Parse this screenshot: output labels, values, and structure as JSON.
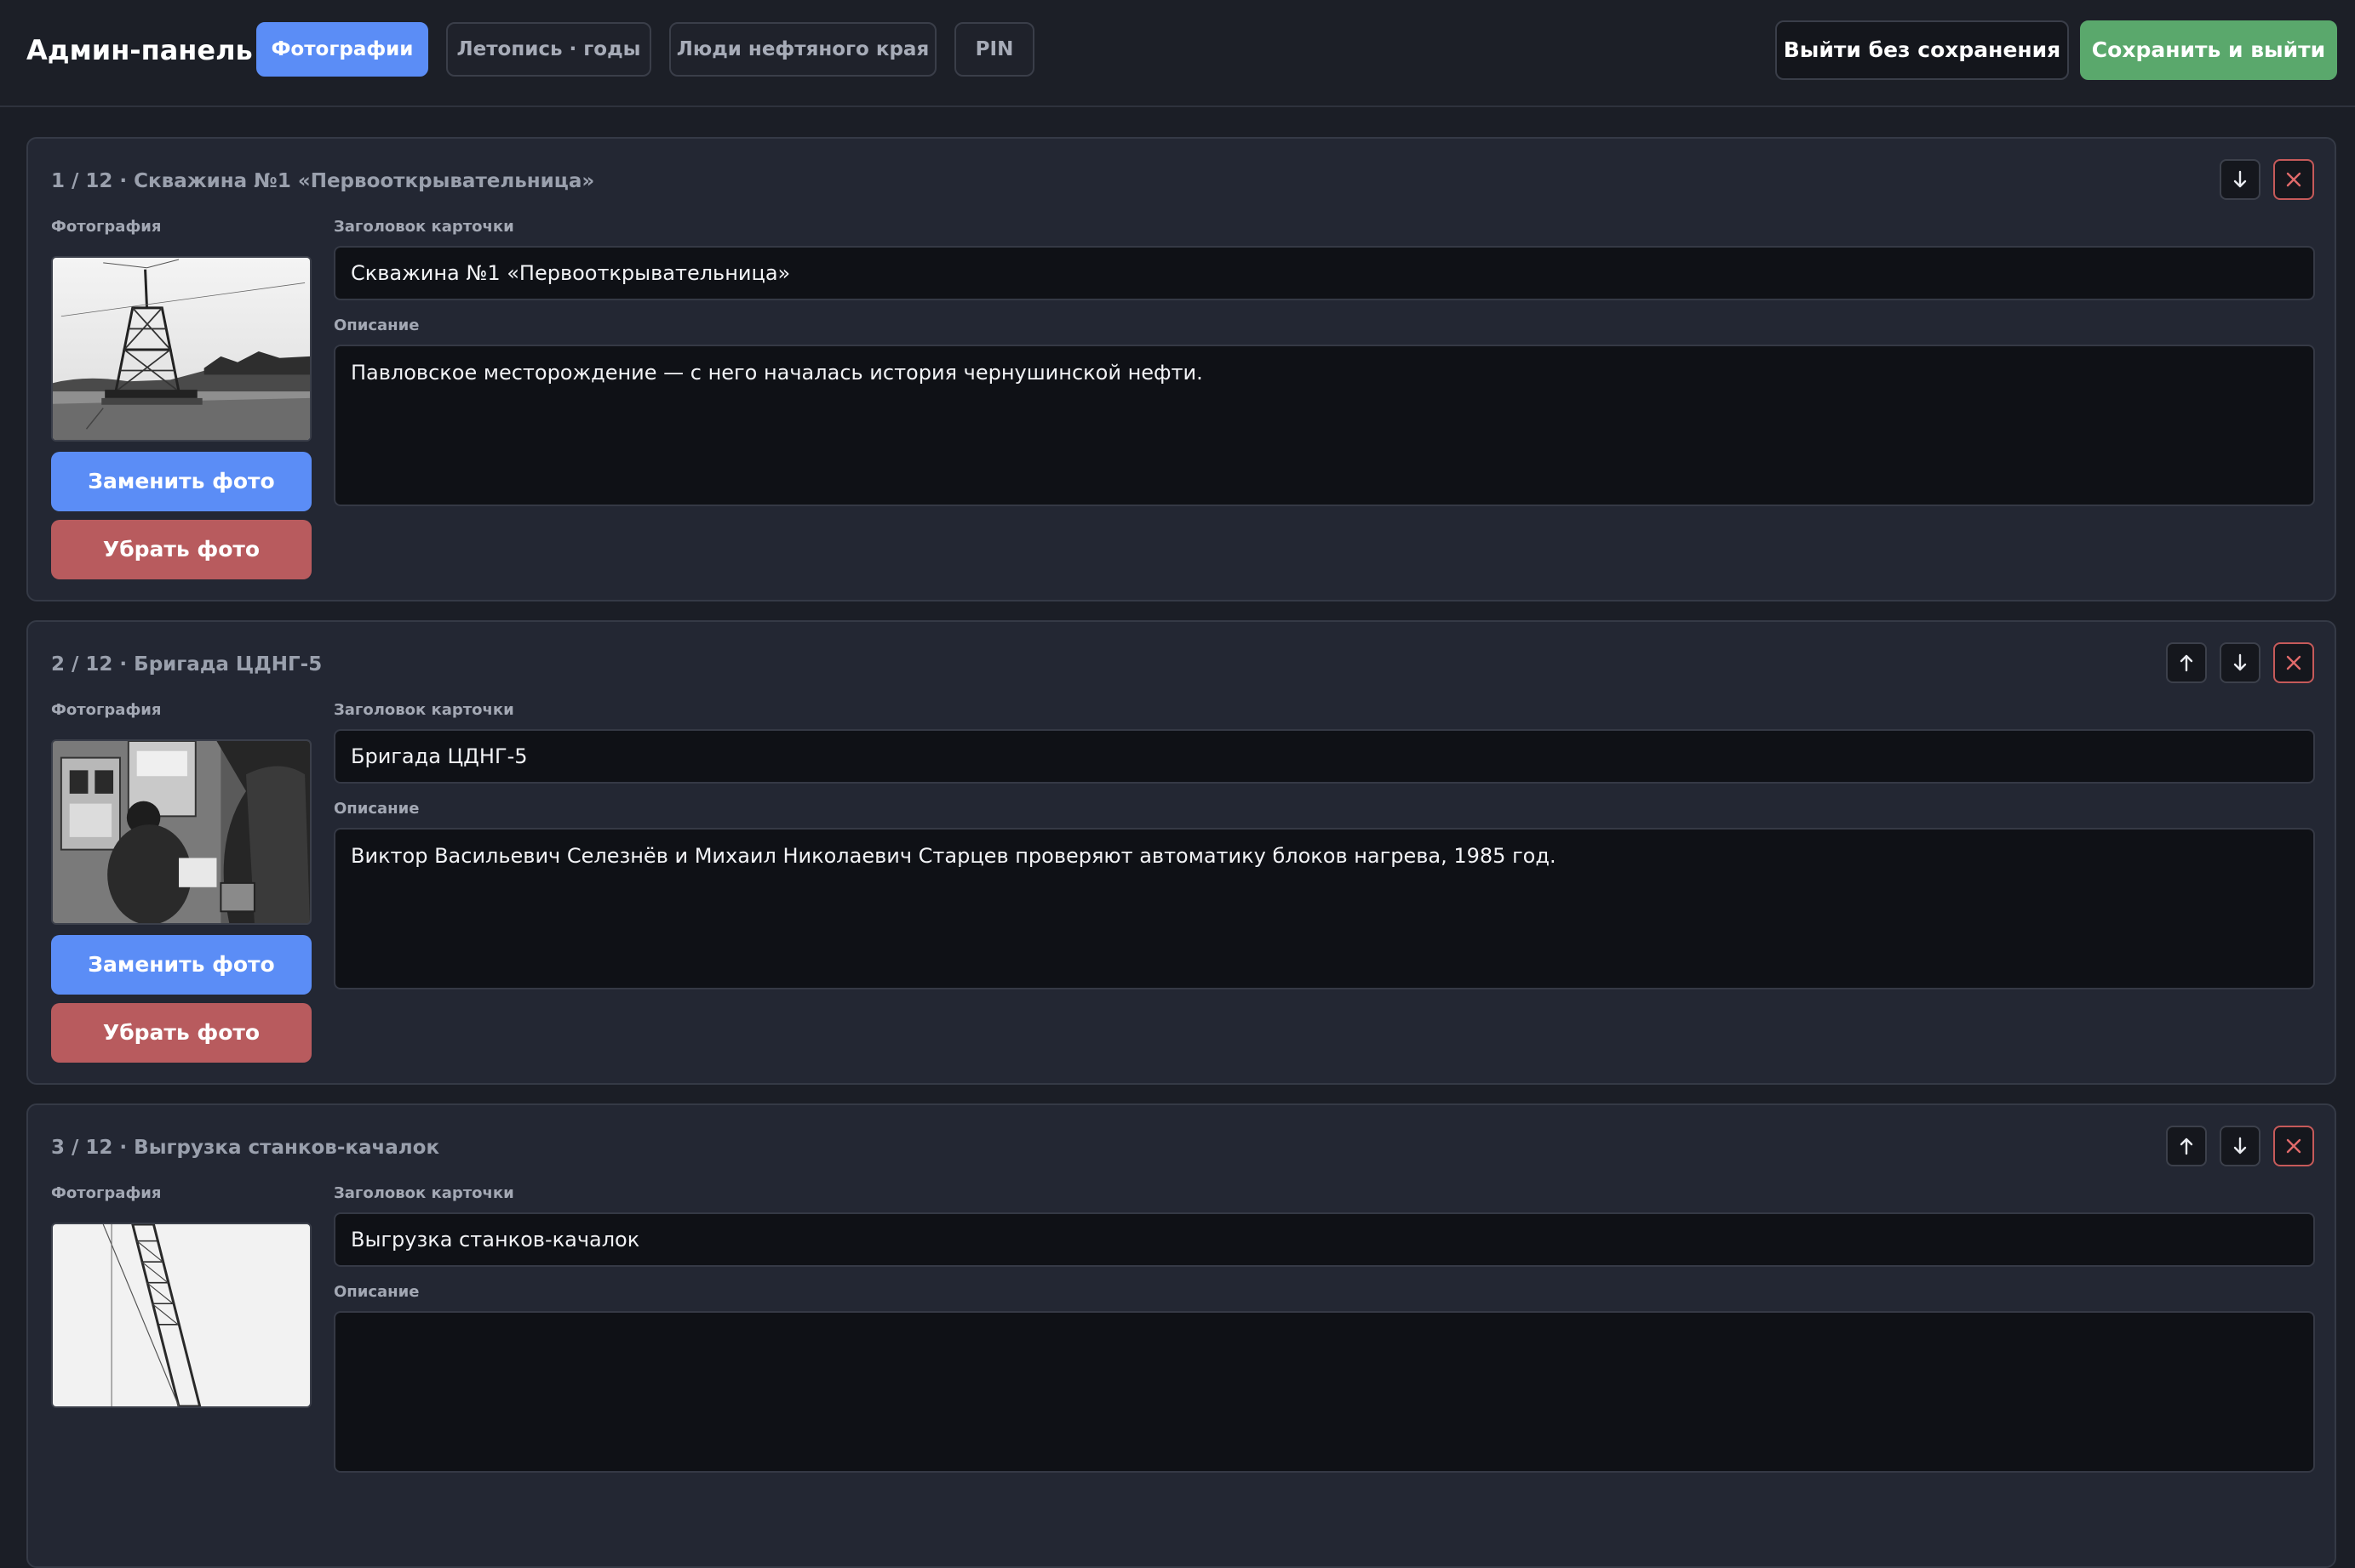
{
  "header": {
    "title": "Админ-панель",
    "tabs": [
      {
        "label": "Фотографии",
        "active": true
      },
      {
        "label": "Летопись · годы",
        "active": false
      },
      {
        "label": "Люди нефтяного края",
        "active": false
      },
      {
        "label": "PIN",
        "active": false
      }
    ],
    "exit_label": "Выйти без сохранения",
    "save_label": "Сохранить и выйти"
  },
  "labels": {
    "photo": "Фотография",
    "card_title": "Заголовок карточки",
    "description": "Описание",
    "replace_photo": "Заменить фото",
    "remove_photo": "Убрать фото"
  },
  "cards": [
    {
      "heading": "1 / 12 · Скважина №1 «Первооткрывательница»",
      "title": "Скважина №1 «Первооткрывательница»",
      "description": "Павловское месторождение — с него началась история чернушинской нефти."
    },
    {
      "heading": "2 / 12 · Бригада ЦДНГ-5",
      "title": "Бригада ЦДНГ-5",
      "description": "Виктор Васильевич Селезнёв и Михаил Николаевич Старцев проверяют автоматику блоков нагрева, 1985 год."
    },
    {
      "heading": "3 / 12 · Выгрузка станков-качалок",
      "title": "Выгрузка станков-качалок",
      "description": ""
    }
  ],
  "colors": {
    "accent_blue": "#5b8df6",
    "save_green": "#5aa86c",
    "remove_red": "#b85b5e",
    "background": "#1b1e26",
    "card": "#232733"
  },
  "icons": {
    "move_up": "arrow-up-icon",
    "move_down": "arrow-down-icon",
    "delete": "close-icon"
  }
}
